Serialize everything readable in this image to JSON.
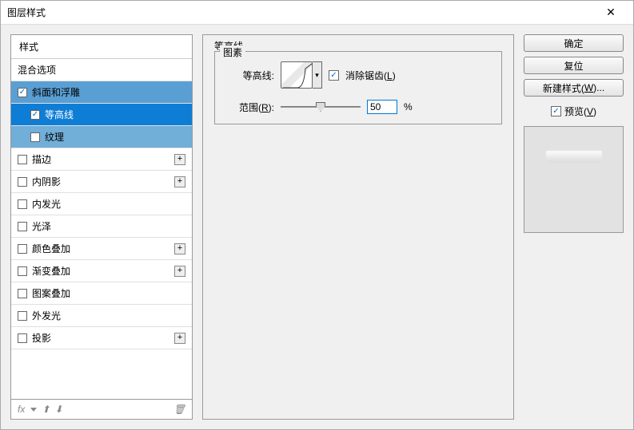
{
  "window": {
    "title": "图层样式"
  },
  "sidebar": {
    "header": "样式",
    "blendOptions": "混合选项",
    "items": [
      {
        "label": "斜面和浮雕",
        "checked": true,
        "selected": "blue",
        "hasAdd": false,
        "sub": false
      },
      {
        "label": "等高线",
        "checked": true,
        "selected": "bright",
        "hasAdd": false,
        "sub": true
      },
      {
        "label": "纹理",
        "checked": false,
        "selected": "light",
        "hasAdd": false,
        "sub": true
      },
      {
        "label": "描边",
        "checked": false,
        "selected": "",
        "hasAdd": true,
        "sub": false
      },
      {
        "label": "内阴影",
        "checked": false,
        "selected": "",
        "hasAdd": true,
        "sub": false
      },
      {
        "label": "内发光",
        "checked": false,
        "selected": "",
        "hasAdd": false,
        "sub": false
      },
      {
        "label": "光泽",
        "checked": false,
        "selected": "",
        "hasAdd": false,
        "sub": false
      },
      {
        "label": "颜色叠加",
        "checked": false,
        "selected": "",
        "hasAdd": true,
        "sub": false
      },
      {
        "label": "渐变叠加",
        "checked": false,
        "selected": "",
        "hasAdd": true,
        "sub": false
      },
      {
        "label": "图案叠加",
        "checked": false,
        "selected": "",
        "hasAdd": false,
        "sub": false
      },
      {
        "label": "外发光",
        "checked": false,
        "selected": "",
        "hasAdd": false,
        "sub": false
      },
      {
        "label": "投影",
        "checked": false,
        "selected": "",
        "hasAdd": true,
        "sub": false
      }
    ],
    "footer": {
      "fx": "fx"
    }
  },
  "main": {
    "groupTitle": "等高线",
    "innerTitle": "图素",
    "contourLabel": "等高线:",
    "antiAlias": "消除锯齿(",
    "antiAliasKey": "L",
    "antiAliasEnd": ")",
    "rangeLabel": "范围(",
    "rangeKey": "R",
    "rangeEnd": "):",
    "rangeValue": "50",
    "rangeUnit": "%"
  },
  "buttons": {
    "ok": "确定",
    "cancel": "复位",
    "newStyle": "新建样式(",
    "newStyleKey": "W",
    "newStyleEnd": ")...",
    "preview": "预览(",
    "previewKey": "V",
    "previewEnd": ")"
  }
}
